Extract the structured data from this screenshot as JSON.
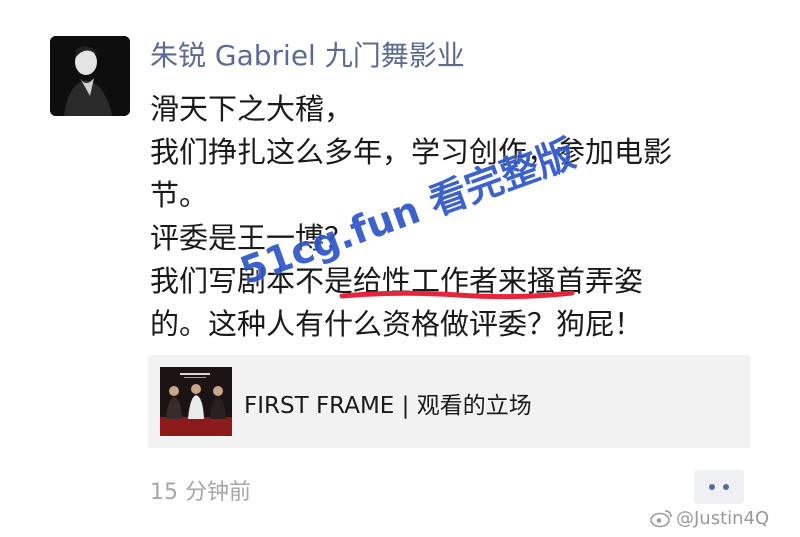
{
  "post": {
    "author": "朱锐 Gabriel 九门舞影业",
    "lines": [
      "滑天下之大稽，",
      "我们挣扎这么多年，学习创作，参加电影",
      "节。",
      "评委是王一博？",
      "我们写剧本不是给性工作者来搔首弄姿",
      "的。这种人有什么资格做评委？狗屁！"
    ],
    "link_title": "FIRST FRAME | 观看的立场",
    "timestamp": "15 分钟前"
  },
  "overlay": {
    "watermark": "51cg.fun 看完整版",
    "handle": "@Justin4Q"
  },
  "colors": {
    "author": "#5c6b93",
    "underline": "#e8243a",
    "watermark": "#2e55c8",
    "card_bg": "#f2f2f2"
  }
}
